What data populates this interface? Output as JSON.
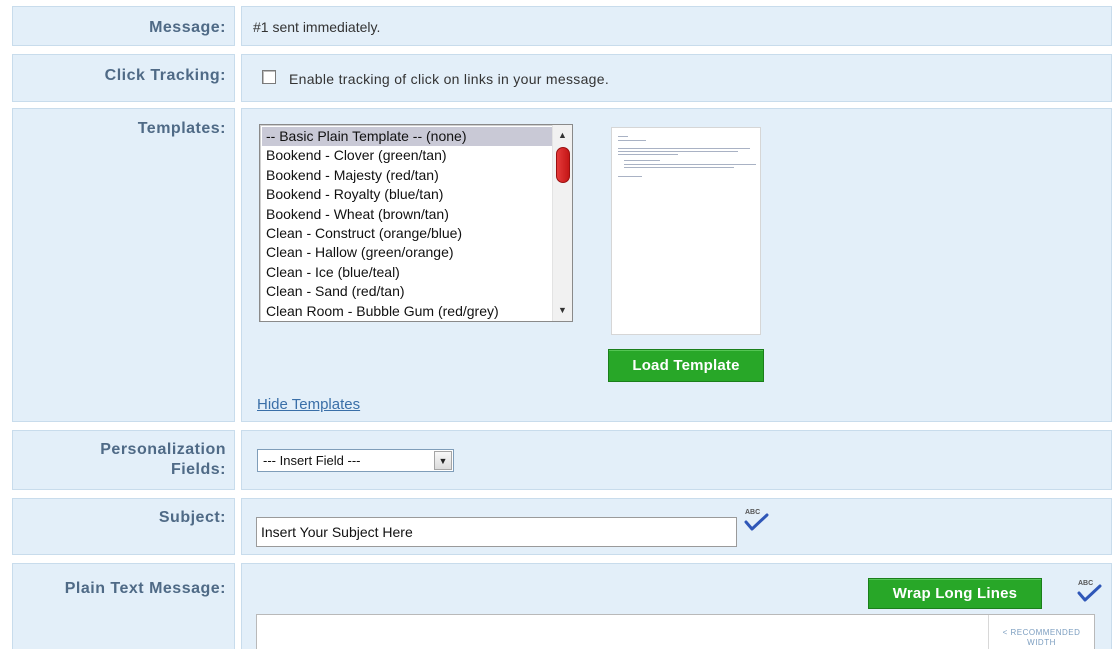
{
  "message": {
    "label": "Message:",
    "value": "#1 sent immediately."
  },
  "click_tracking": {
    "label": "Click Tracking:",
    "checkbox_label": "Enable tracking of click on links in your message.",
    "checked": false
  },
  "templates": {
    "label": "Templates:",
    "items": [
      "-- Basic Plain Template -- (none)",
      "Bookend - Clover (green/tan)",
      "Bookend - Majesty (red/tan)",
      "Bookend - Royalty (blue/tan)",
      "Bookend - Wheat (brown/tan)",
      "Clean - Construct (orange/blue)",
      "Clean - Hallow (green/orange)",
      "Clean - Ice (blue/teal)",
      "Clean - Sand (red/tan)",
      "Clean Room - Bubble Gum (red/grey)"
    ],
    "selected_index": 0,
    "load_button": "Load Template",
    "hide_link": "Hide Templates"
  },
  "personalization": {
    "label_line1": "Personalization",
    "label_line2": "Fields:",
    "select_value": "--- Insert Field ---"
  },
  "subject": {
    "label": "Subject:",
    "value": "Insert Your Subject Here"
  },
  "plain_text": {
    "label": "Plain Text Message:",
    "wrap_button": "Wrap Long Lines",
    "recommended_width": "< RECOMMENDED WIDTH"
  },
  "icons": {
    "spellcheck": "spellcheck-icon",
    "scroll_up": "chevron-up-icon",
    "scroll_down": "chevron-down-icon",
    "dropdown": "chevron-down-icon"
  },
  "colors": {
    "row_bg": "#e3eff9",
    "label_text": "#4f6a86",
    "button_green": "#28a728",
    "link_blue": "#3a6fa8",
    "scroll_thumb": "#d42a2a"
  }
}
